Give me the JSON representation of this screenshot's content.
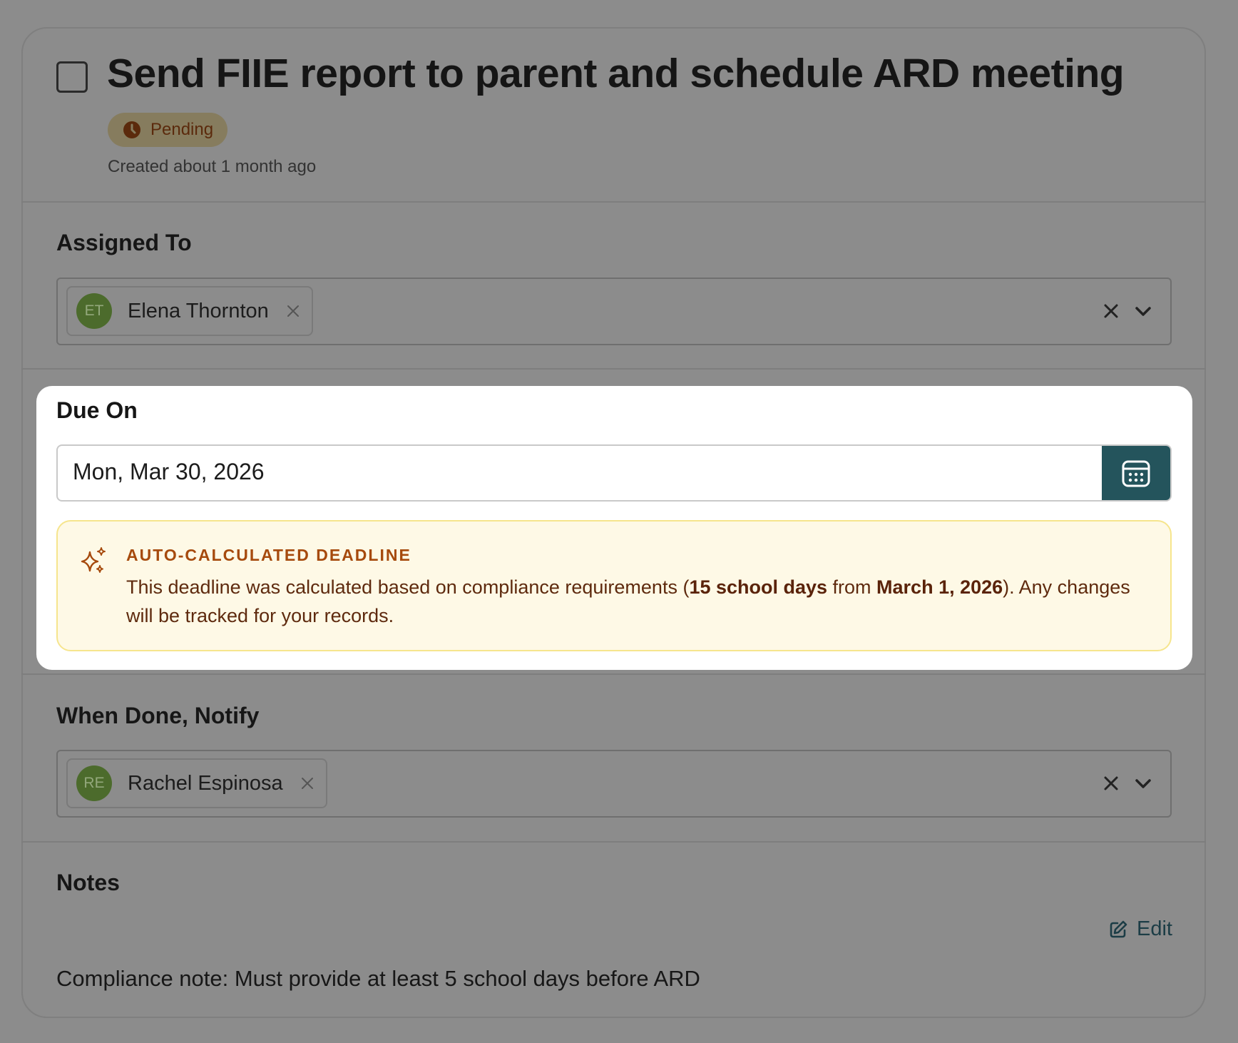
{
  "task": {
    "title": "Send FIIE report to parent and schedule ARD meeting",
    "status": "Pending",
    "created": "Created about 1 month ago",
    "completed": false
  },
  "assigned_to": {
    "label": "Assigned To",
    "chips": [
      {
        "initials": "ET",
        "name": "Elena Thornton"
      }
    ]
  },
  "due_on": {
    "label": "Due On",
    "value": "Mon, Mar 30, 2026"
  },
  "alert": {
    "title": "AUTO-CALCULATED DEADLINE",
    "text_before": "This deadline was calculated based on compliance requirements (",
    "days": "15 school days",
    "text_from": " from ",
    "start_date": "March 1, 2026",
    "text_after": "). Any changes will be tracked for your records."
  },
  "notify": {
    "label": "When Done, Notify",
    "chips": [
      {
        "initials": "RE",
        "name": "Rachel Espinosa"
      }
    ]
  },
  "notes": {
    "label": "Notes",
    "edit_label": "Edit",
    "text": "Compliance note: Must provide at least 5 school days before ARD"
  },
  "colors": {
    "backdrop": "#8c8c8c",
    "accent_teal": "#24545c",
    "alert_bg": "#fef9e6",
    "alert_border": "#f6e58d",
    "alert_title": "#a64a0d",
    "avatar_green": "#4c6b2c",
    "pending_text": "#5b2a0c"
  }
}
